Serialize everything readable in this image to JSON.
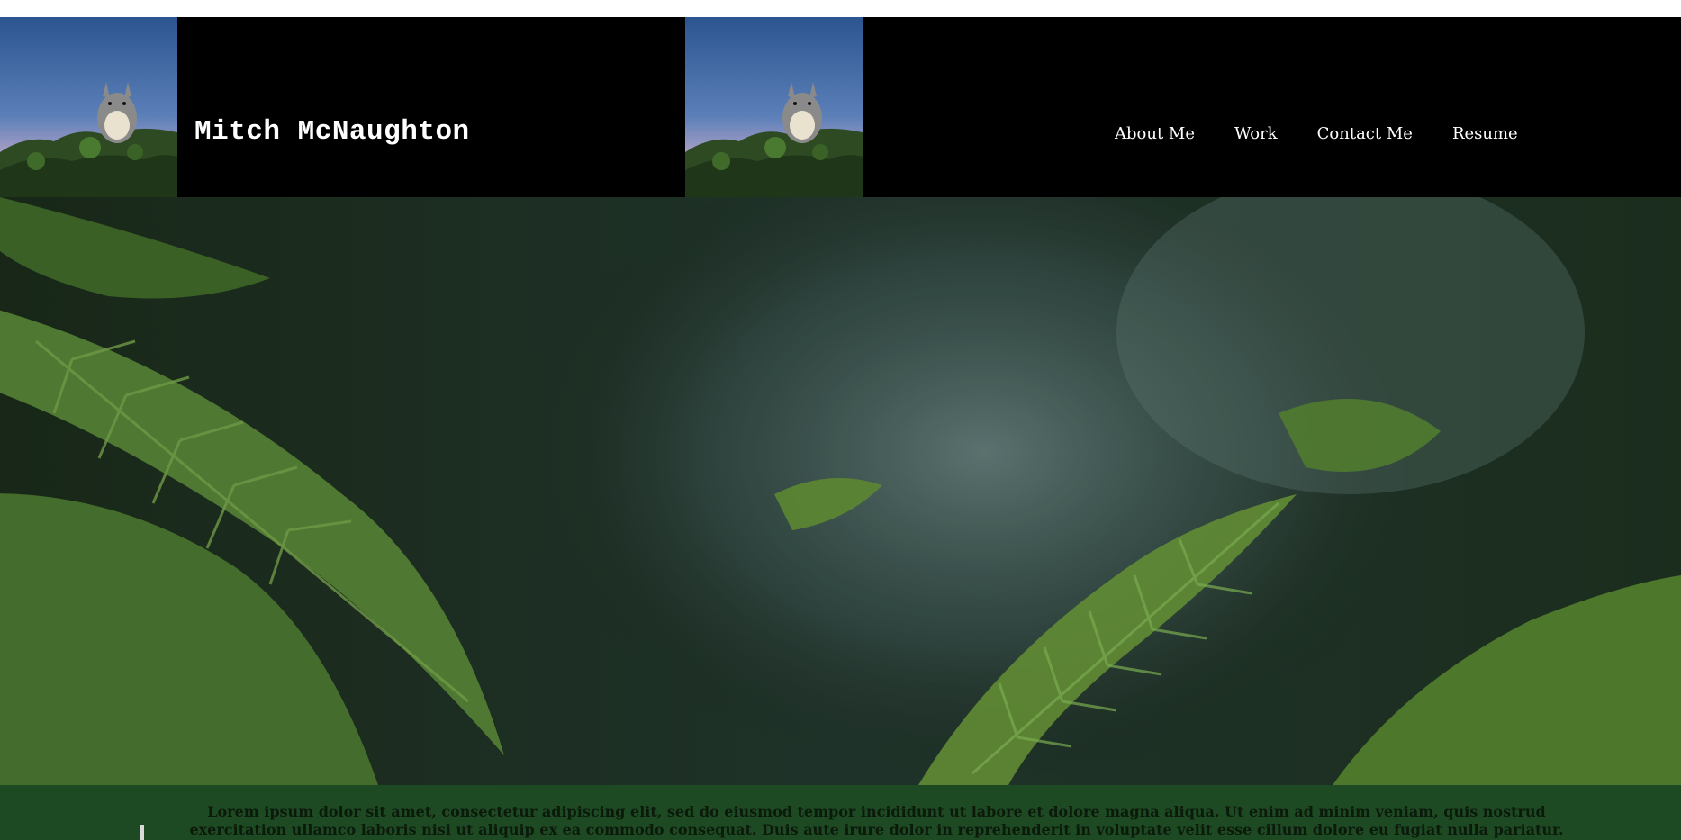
{
  "header": {
    "site_name": "Mitch McNaughton",
    "logo_icon": "totoro-on-treetop-icon"
  },
  "nav": {
    "items": [
      {
        "label": "About Me"
      },
      {
        "label": "Work"
      },
      {
        "label": "Contact Me"
      },
      {
        "label": "Resume"
      }
    ]
  },
  "hero": {
    "image": "fern-forest-with-mist"
  },
  "footer": {
    "intro_text": "Lorem ipsum dolor sit amet, consectetur adipiscing elit, sed do eiusmod tempor incididunt ut labore et dolore magna aliqua. Ut enim ad minim veniam, quis nostrud exercitation ullamco laboris nisi ut aliquip ex ea commodo consequat. Duis aute irure dolor in reprehenderit in voluptate velit esse cillum dolore eu fugiat nulla pariatur. Excepteur sint"
  },
  "colors": {
    "header_bg": "#000000",
    "nav_text": "#ffffff",
    "footer_bg": "#1e4a23",
    "footer_text": "#0b1a0b"
  }
}
